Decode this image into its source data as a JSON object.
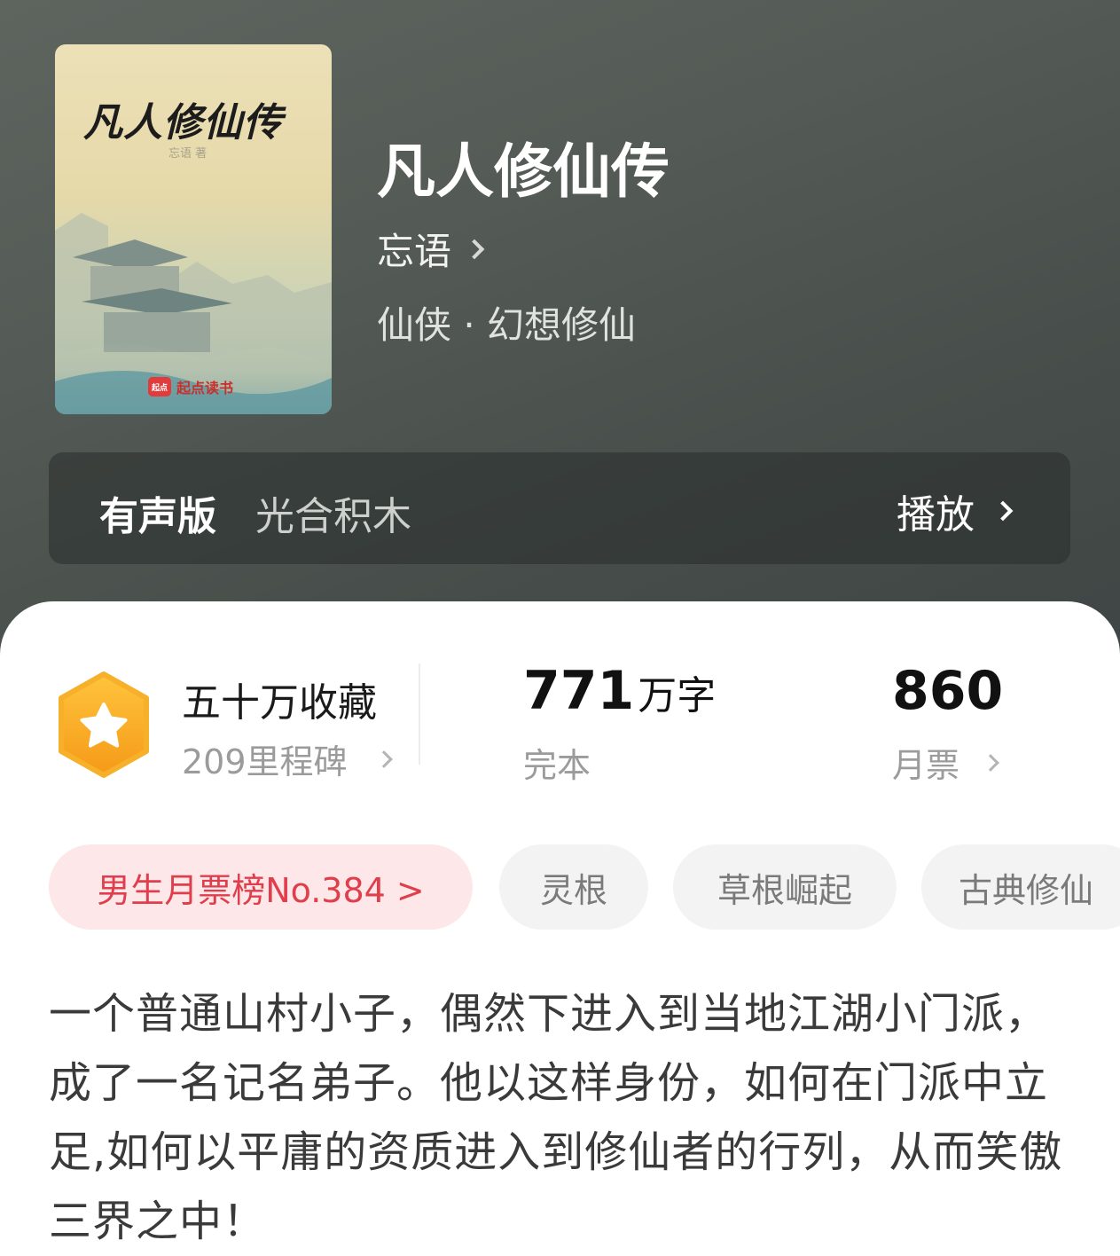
{
  "book": {
    "title": "凡人修仙传",
    "author": "忘语",
    "genre": "仙侠 · 幻想修仙"
  },
  "cover": {
    "title": "凡人修仙传",
    "author": "忘语 著",
    "brand": "起点读书",
    "brand_logo": "起点"
  },
  "audio": {
    "label": "有声版",
    "narrator": "光合积木",
    "play_label": "播放"
  },
  "stats": {
    "collection": "五十万收藏",
    "milestone": "209里程碑",
    "word_count": "771",
    "word_unit": "万字",
    "status": "完本",
    "monthly_tickets": "860",
    "tickets_label": "月票"
  },
  "tags": {
    "rank": "男生月票榜No.384 >",
    "items": [
      "灵根",
      "草根崛起",
      "古典修仙"
    ]
  },
  "intro": "一个普通山村小子，偶然下进入到当地江湖小门派，成了一名记名弟子。他以这样身份，如何在门派中立足,如何以平庸的资质进入到修仙者的行列，从而笑傲三界之中！",
  "colors": {
    "accent_red": "#e03e4c",
    "rank_tag_bg": "#fde7e8",
    "badge_orange": "#f7a623",
    "hero_bg": "#545a55"
  }
}
